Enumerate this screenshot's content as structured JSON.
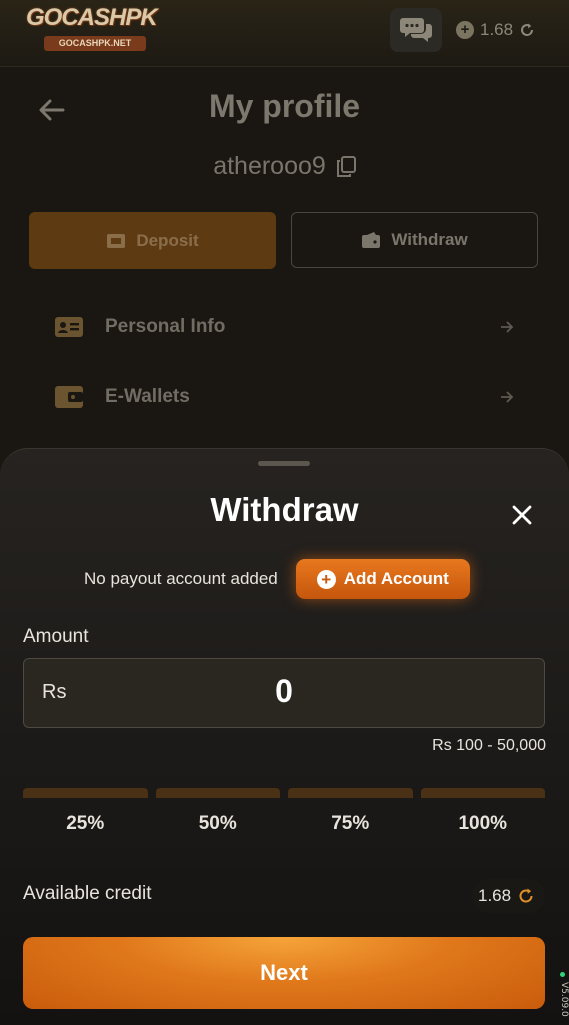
{
  "header": {
    "logo_text": "GOCASHPK",
    "logo_subtext": "GOCASHPK.NET",
    "balance": "1.68",
    "icons": [
      "chat-icon",
      "plus-circle-icon",
      "refresh-icon"
    ]
  },
  "profile": {
    "title": "My profile",
    "username": "atherooo9",
    "deposit_label": "Deposit",
    "withdraw_label": "Withdraw",
    "menu": [
      {
        "label": "Personal Info",
        "icon": "id-card-icon"
      },
      {
        "label": "E-Wallets",
        "icon": "wallet-icon"
      }
    ]
  },
  "sheet": {
    "title": "Withdraw",
    "payout_text": "No payout account added",
    "add_account_label": "Add Account",
    "amount_label": "Amount",
    "currency": "Rs",
    "amount_value": "0",
    "range": "Rs 100 - 50,000",
    "percentages": [
      "25%",
      "50%",
      "75%",
      "100%"
    ],
    "available_credit_label": "Available credit",
    "available_credit": "1.68",
    "next_label": "Next"
  },
  "side_label": "V5.09.0",
  "colors": {
    "accent": "#e0781b",
    "accent_dark": "#c5560c",
    "background": "#1a1712",
    "sheet": "#262320"
  }
}
